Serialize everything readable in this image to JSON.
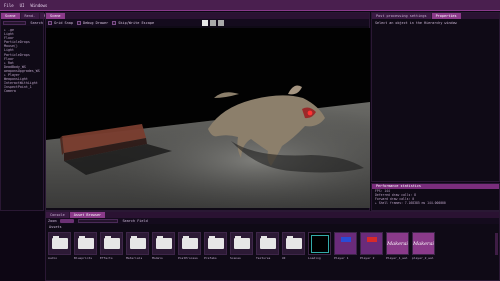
{
  "menu": [
    "File",
    "UI",
    "Windows"
  ],
  "left_panel": {
    "tabs": [
      "Scene",
      "Rend.",
      "Mat.",
      "Wo"
    ],
    "search_label": "Search",
    "tree": [
      "▸ .ge",
      "  Light",
      "  Floor",
      "  ParticleDrops",
      "  Mouse()",
      "  Light",
      "  ParticleDrops",
      "Floor",
      "▸ Rat",
      "  DeadBody_WS",
      "  weaponsUpgrades_WS",
      "▸ Player",
      "  WeaponsLight",
      "  InteractWithLight",
      "  InspectPoint_1",
      "Camera"
    ]
  },
  "scene_panel": {
    "tab": "Scene",
    "toolbar": {
      "grid_snap": "Grid Snap",
      "debug_draw": "Debug Drawer",
      "wireframe": "Skip/Write Escape"
    },
    "playback_icons": [
      "play-icon",
      "pause-icon",
      "step-icon"
    ]
  },
  "right_panel": {
    "tabs": [
      "Post processing settings",
      "Properties"
    ],
    "placeholder": "Select an object in the Hierarchy window"
  },
  "performance": {
    "title": "Performance statistics",
    "lines": [
      "FPS: 144",
      "Deferred draw calls: 8",
      "Forward draw calls: 0",
      "▸ Shell frames: 7.168385 ms 144.000000"
    ]
  },
  "content_browser": {
    "tabs": [
      "Console",
      "Asset Browser"
    ],
    "path": "Zoom",
    "breadcrumb": "Assets",
    "search_label": "Search Field",
    "items": [
      {
        "name": "Audio",
        "kind": "folder"
      },
      {
        "name": "Blueprints",
        "kind": "folder"
      },
      {
        "name": "Effects",
        "kind": "folder"
      },
      {
        "name": "Materials",
        "kind": "folder"
      },
      {
        "name": "Models",
        "kind": "folder"
      },
      {
        "name": "PostProcess",
        "kind": "folder"
      },
      {
        "name": "Prefabs",
        "kind": "folder"
      },
      {
        "name": "Scenes",
        "kind": "folder"
      },
      {
        "name": "Textures",
        "kind": "folder"
      },
      {
        "name": "UI",
        "kind": "folder"
      },
      {
        "name": "Loading",
        "kind": "black"
      },
      {
        "name": "Player 1",
        "kind": "blue-logo"
      },
      {
        "name": "Player 2",
        "kind": "red-logo"
      },
      {
        "name": "Player_1_wal",
        "kind": "text-logo"
      },
      {
        "name": "player_2_wal",
        "kind": "text-logo"
      }
    ],
    "logo_text": "Makerai"
  },
  "colors": {
    "accent": "#8b3a8a",
    "bg": "#0f0a16"
  }
}
